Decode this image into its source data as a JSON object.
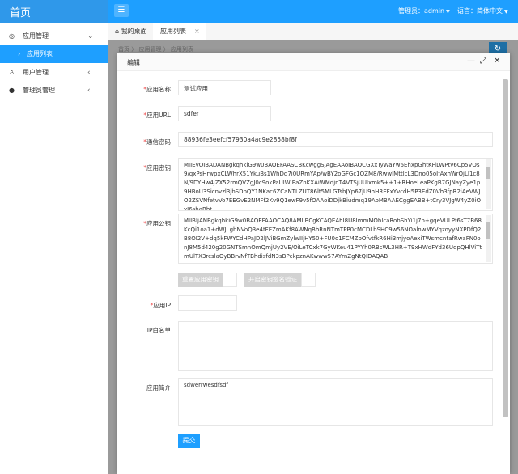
{
  "header": {
    "brand": "首页",
    "menu_icon": "☰",
    "user_label": "管理员：admin",
    "lang_label": "语言：简体中文"
  },
  "sidebar": {
    "items": [
      {
        "label": "应用管理",
        "icon": "◎",
        "arrow": "⌄"
      },
      {
        "label": "应用列表",
        "icon": "›"
      },
      {
        "label": "用户管理",
        "icon": "♙",
        "arrow": "‹"
      },
      {
        "label": "管理员管理",
        "icon": "●",
        "arrow": "‹"
      }
    ]
  },
  "tabs": {
    "home_label": "我的桌面",
    "home_icon": "⌂",
    "active_label": "应用列表",
    "close_icon": "×"
  },
  "breadcrumb": "首页 〉 应用管理 〉 应用列表",
  "modal": {
    "title": "编辑",
    "fields": {
      "app_name": {
        "label": "应用名称",
        "value": "测试应用"
      },
      "app_url": {
        "label": "应用URL",
        "value": "sdfer"
      },
      "comm_key": {
        "label": "通信密码",
        "value": "88936fe3eefcf57930a4ac9e2858bf8f"
      },
      "private_key": {
        "label": "应用密钥",
        "value": "MIIEvQIBADANBgkqhkiG9w0BAQEFAASCBKcwggSjAgEAAoIBAQCGXxTyWaYw6EhxpGhtKFiLWPtv6Cp5VQs9/qxPsHrwpxCLWhrX51YkuBs1WhDd7i0URmYAp/wBY2oGFGc1OZM8/RwwIMttlcL3Dno05oIfAxhWrOjLI1c8N/9DYHw4jZX52rmQVZgJ0c9okPaUlWIEaZnKXAiWMdjnT4VTSjUUlxmk5++1+RHoeLeaPKgB7GJNayZye1p9HBoU3Sicnvzl3jbSDbQY1NKac6ZCaNTLZUT86lt5MLGTsbJYp67jU9hHREFxYvcdH5P3EdZ0Vh3fpR2iAeVWJO2ZSVNfetvVo7EEGvE2NMFf2Kv9Q1ewF9v5fOAAoiDDjkBiudmq19AoMBAAECggEABB+tCry3VJgW4yZ0iOvI6shaBht"
      },
      "public_key": {
        "label": "应用公钥",
        "value": "MIIBIjANBgkqhkiG9w0BAQEFAAOCAQ8AMIIBCgKCAQEAhI8U8ImmMOhlcaRobShYi1j7b+gqeVULPf6sT7B68KcQi1oa1+dWJLgbNVoQ3e4tFEZmAKf8AWNqBhRnNTmTPP0cMCDLbSHC9w56NOalnwMYVqzoyyNXPDfQ2B8OI2V+dq5kFWYCdHPaJD2lJViBGmZylwIIjHY50+FU0o1FCMZpOfvtfkR6Hi3mjyoAexiTWsmcntafRwaFN0onJ8M5d420g20GNTSmnOmQmjUy2VE/OiLeTCxk7GyWKeu41PYYh0RBcWL3HR+T9xHWdFYd36UdpQHlViTtmUlTX3rcslaOyBBrvNfTBhdisfdN3sBPckpznAKwww57AYrnZgNtQIDAQAB"
      },
      "reset_btn": "重置应用密钥",
      "verify_btn": "开启密钥签名验证",
      "app_ip": {
        "label": "应用IP",
        "value": ""
      },
      "ip_whitelist": {
        "label": "IP白名单",
        "value": ""
      },
      "app_intro": {
        "label": "应用简介",
        "value": "sdwerrwesdfsdf"
      },
      "submit": "提交"
    }
  },
  "colors": {
    "accent": "#1e9fff",
    "overlay": "#9a9a9a"
  }
}
